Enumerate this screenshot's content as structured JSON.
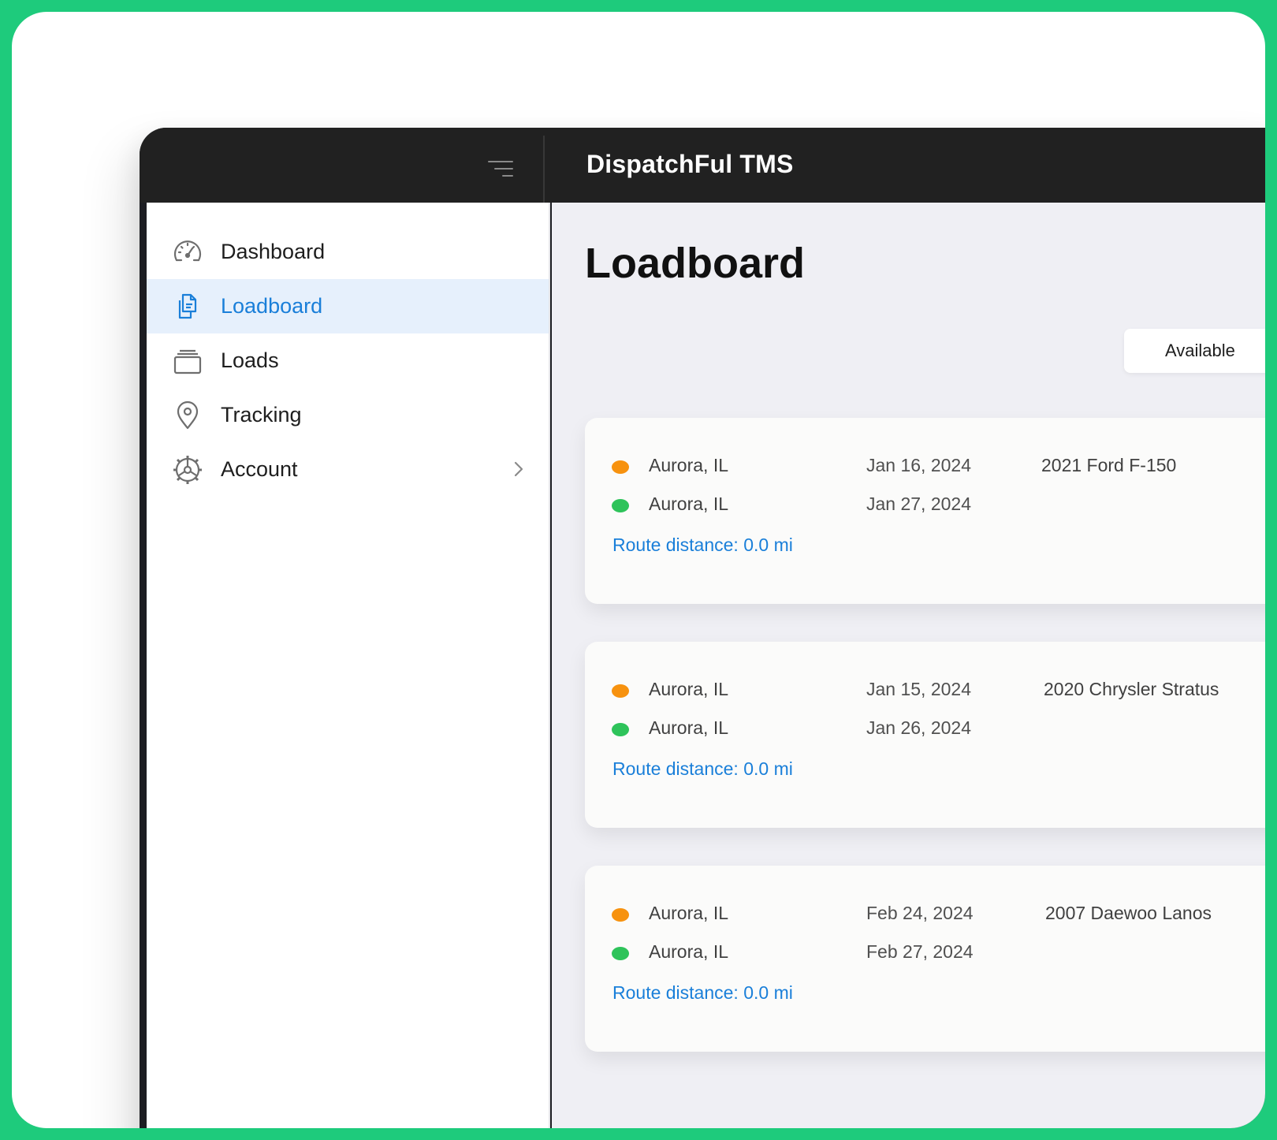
{
  "app": {
    "title": "DispatchFul TMS"
  },
  "sidebar": {
    "items": [
      {
        "label": "Dashboard",
        "icon": "speedometer-icon",
        "active": false
      },
      {
        "label": "Loadboard",
        "icon": "documents-icon",
        "active": true
      },
      {
        "label": "Loads",
        "icon": "stack-icon",
        "active": false
      },
      {
        "label": "Tracking",
        "icon": "location-pin-icon",
        "active": false
      },
      {
        "label": "Account",
        "icon": "gear-icon",
        "active": false,
        "has_submenu": true
      }
    ]
  },
  "main": {
    "title": "Loadboard",
    "filter": {
      "label": "Available"
    },
    "loads": [
      {
        "origin_city": "Aurora, IL",
        "origin_date": "Jan 16, 2024",
        "dest_city": "Aurora, IL",
        "dest_date": "Jan 27, 2024",
        "vehicle": "2021 Ford F-150",
        "route": "Route distance: 0.0 mi"
      },
      {
        "origin_city": "Aurora, IL",
        "origin_date": "Jan 15, 2024",
        "dest_city": "Aurora, IL",
        "dest_date": "Jan 26, 2024",
        "vehicle": "2020 Chrysler Stratus",
        "route": "Route distance: 0.0 mi"
      },
      {
        "origin_city": "Aurora, IL",
        "origin_date": "Feb 24, 2024",
        "dest_city": "Aurora, IL",
        "dest_date": "Feb 27, 2024",
        "vehicle": "2007 Daewoo Lanos",
        "route": "Route distance: 0.0 mi"
      }
    ]
  },
  "colors": {
    "brand_green": "#1ecb7c",
    "accent_blue": "#1a7fd9",
    "origin_dot": "#f7920f",
    "destination_dot": "#2ec35a",
    "topbar": "#212121"
  }
}
